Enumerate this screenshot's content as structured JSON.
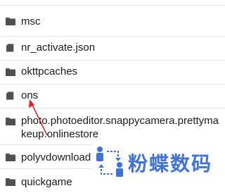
{
  "file_list": {
    "items": [
      {
        "name": "msc",
        "type": "folder"
      },
      {
        "name": "nr_activate.json",
        "type": "file"
      },
      {
        "name": "okttpcaches",
        "type": "folder"
      },
      {
        "name": "ons",
        "type": "file"
      },
      {
        "name": "photo.photoeditor.snappycamera.prettymakeup.onlinestore",
        "type": "folder"
      },
      {
        "name": "polyvdownload",
        "type": "folder"
      },
      {
        "name": "quickgame",
        "type": "folder"
      }
    ]
  },
  "watermark": {
    "text": "粉蝶数码",
    "icon": "people-swap-icon",
    "color": "#3f73d7"
  },
  "annotation": {
    "icon": "red-arrow-icon",
    "color": "#e02020"
  }
}
